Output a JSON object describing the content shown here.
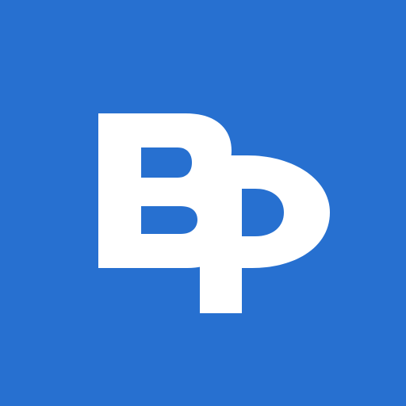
{
  "app_icon": {
    "logo_text": "BP",
    "icon_name": "bp-logo-icon",
    "colors": {
      "background": "#2770d0",
      "glyph": "#ffffff"
    }
  }
}
